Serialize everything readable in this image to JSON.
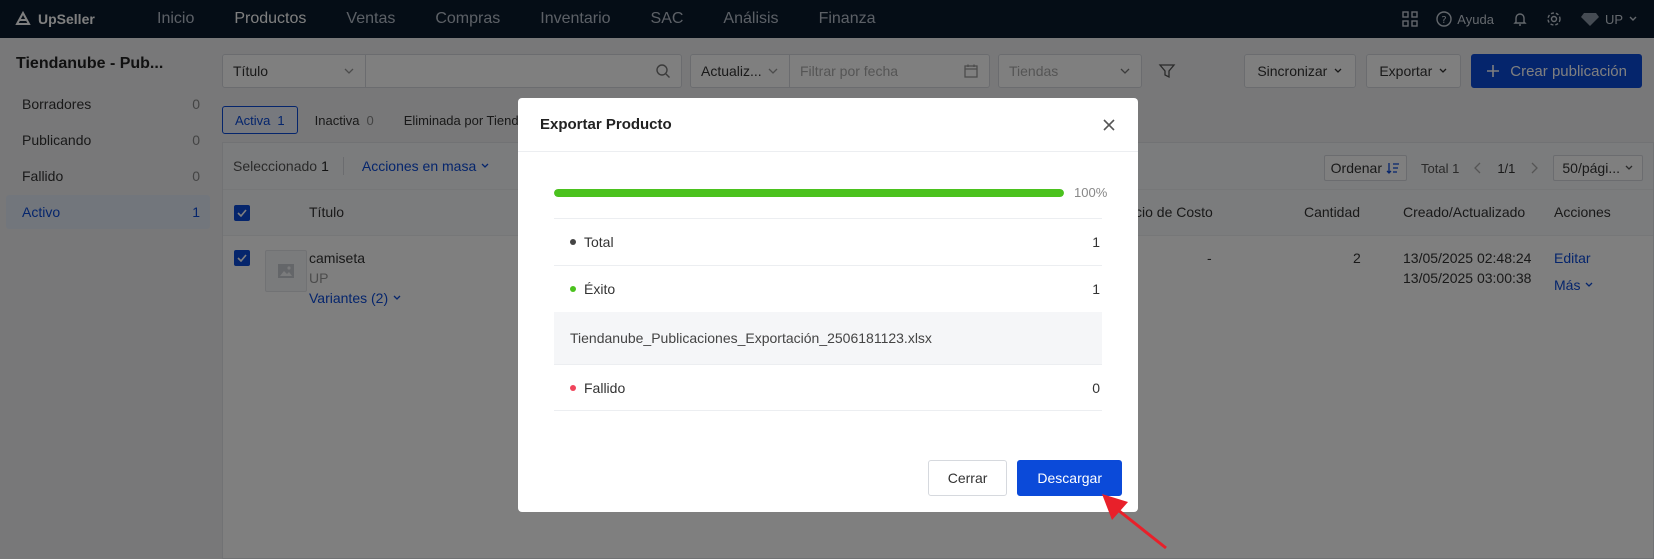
{
  "brand": {
    "name": "UpSeller"
  },
  "nav": {
    "items": [
      "Inicio",
      "Productos",
      "Ventas",
      "Compras",
      "Inventario",
      "SAC",
      "Análisis",
      "Finanza"
    ],
    "active_index": 1
  },
  "topbar_right": {
    "help": "Ayuda",
    "user": "UP"
  },
  "sidebar": {
    "title": "Tiendanube - Pub...",
    "items": [
      {
        "label": "Borradores",
        "count": "0"
      },
      {
        "label": "Publicando",
        "count": "0"
      },
      {
        "label": "Fallido",
        "count": "0"
      },
      {
        "label": "Activo",
        "count": "1"
      }
    ],
    "active_index": 3
  },
  "filters": {
    "title_select": "Título",
    "date_select": "Actualiz...",
    "date_placeholder": "Filtrar por fecha",
    "stores_placeholder": "Tiendas",
    "sync_label": "Sincronizar",
    "export_label": "Exportar",
    "create_label": "Crear publicación"
  },
  "tabs": [
    {
      "label": "Activa",
      "count": "1"
    },
    {
      "label": "Inactiva",
      "count": "0"
    },
    {
      "label": "Eliminada por Tiendanube",
      "count": ""
    }
  ],
  "toolbar": {
    "selected_label": "Seleccionado",
    "selected_count": "1",
    "mass_actions": "Acciones en masa",
    "sort_label": "Ordenar",
    "total": "Total 1",
    "page": "1/1",
    "page_size": "50/pági..."
  },
  "table": {
    "headers": {
      "title": "Título",
      "cost": "cio de Costo",
      "quantity": "Cantidad",
      "created": "Creado/Actualizado",
      "actions": "Acciones"
    },
    "row": {
      "name": "camiseta",
      "store": "UP",
      "variants": "Variantes (2)",
      "cost": "-",
      "quantity": "2",
      "created": "13/05/2025 02:48:24",
      "updated": "13/05/2025 03:00:38",
      "edit": "Editar",
      "more": "Más"
    }
  },
  "modal": {
    "title": "Exportar Producto",
    "progress_percent": 100,
    "progress_label": "100%",
    "stats": {
      "total_label": "Total",
      "total_value": "1",
      "success_label": "Éxito",
      "success_value": "1",
      "failed_label": "Fallido",
      "failed_value": "0"
    },
    "file_name": "Tiendanube_Publicaciones_Exportación_2506181123.xlsx",
    "close_label": "Cerrar",
    "download_label": "Descargar"
  },
  "colors": {
    "accent": "#0b4ad9",
    "progress": "#4bc21e",
    "total_dot": "#444444",
    "success_dot": "#4bc21e",
    "failed_dot": "#f0445b",
    "annotation_arrow": "#e8202a"
  }
}
